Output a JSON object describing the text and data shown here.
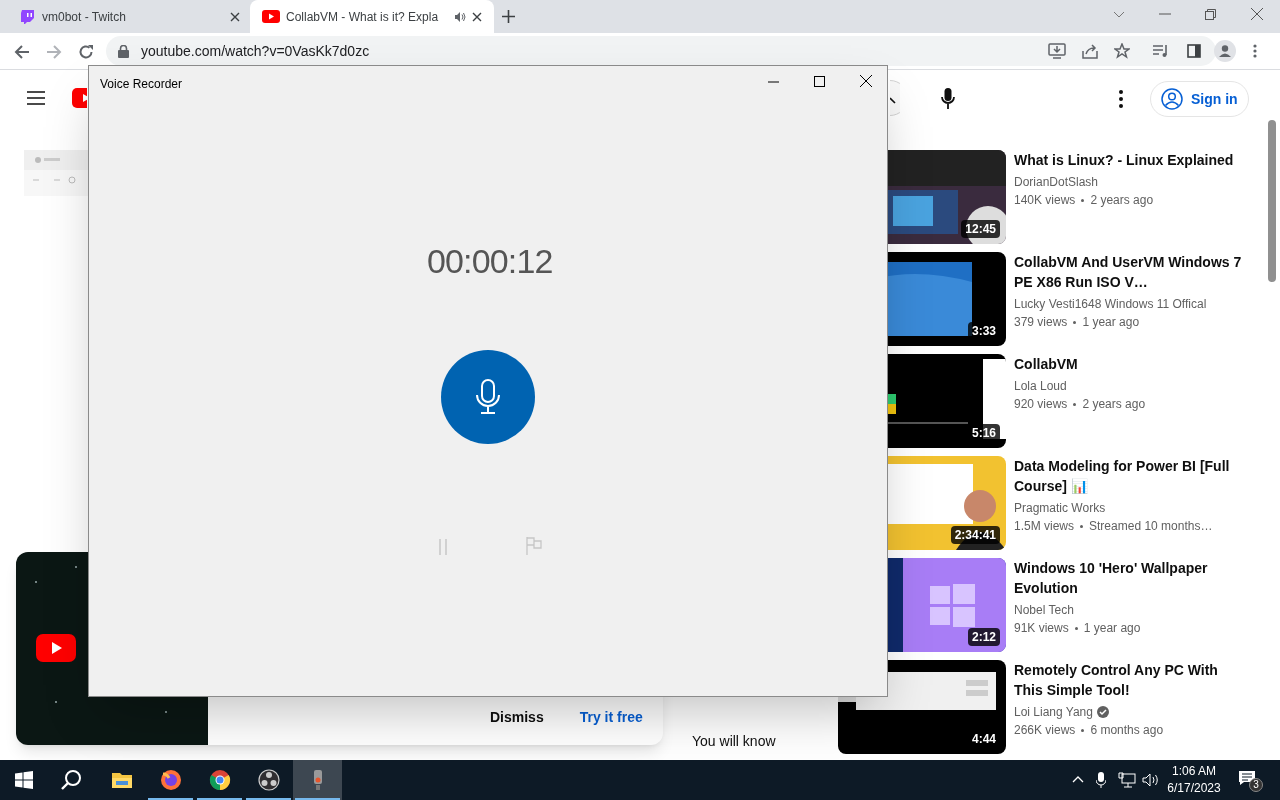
{
  "browser": {
    "tabs": [
      {
        "title": "vm0bot - Twitch",
        "kind": "twitch",
        "selected": false,
        "audio": false
      },
      {
        "title": "CollabVM - What is it? Expla",
        "kind": "youtube",
        "selected": true,
        "audio": true
      }
    ],
    "url": "youtube.com/watch?v=0VasKk7d0zc"
  },
  "youtube": {
    "sign_in": "Sign in",
    "recommendations": [
      {
        "title": "What is Linux? - Linux Explained",
        "channel": "DorianDotSlash",
        "views": "140K views",
        "age": "2 years ago",
        "duration": "12:45",
        "verified": false
      },
      {
        "title": "CollabVM And UserVM Windows 7 PE X86 Run ISO V…",
        "channel": "Lucky Vesti1648 Windows 11 Offical",
        "views": "379 views",
        "age": "1 year ago",
        "duration": "3:33",
        "verified": false
      },
      {
        "title": "CollabVM",
        "channel": "Lola Loud",
        "views": "920 views",
        "age": "2 years ago",
        "duration": "5:16",
        "verified": false
      },
      {
        "title": "Data Modeling for Power BI [Full Course] 📊",
        "channel": "Pragmatic Works",
        "views": "1.5M views",
        "age": "Streamed 10 months…",
        "duration": "2:34:41",
        "verified": false
      },
      {
        "title": "Windows 10 'Hero' Wallpaper Evolution",
        "channel": "Nobel Tech",
        "views": "91K views",
        "age": "1 year ago",
        "duration": "2:12",
        "verified": false
      },
      {
        "title": "Remotely Control Any PC With This Simple Tool!",
        "channel": "Loi Liang Yang",
        "views": "266K views",
        "age": "6 months ago",
        "duration": "4:44",
        "verified": true
      }
    ],
    "promo": {
      "buttons": [
        {
          "label": "Dismiss",
          "kind": "plain"
        },
        {
          "label": "Try it free",
          "kind": "primary"
        }
      ]
    },
    "description": "You will know"
  },
  "recorder": {
    "title": "Voice Recorder",
    "elapsed": "00:00:12",
    "controls_disabled": true
  },
  "taskbar": {
    "apps": [
      {
        "kind": "explorer",
        "running": false,
        "selected": false
      },
      {
        "kind": "firefox",
        "running": true,
        "selected": false
      },
      {
        "kind": "chrome",
        "running": true,
        "selected": false
      },
      {
        "kind": "obs",
        "running": true,
        "selected": false
      },
      {
        "kind": "recorder",
        "running": true,
        "selected": true
      }
    ],
    "time": "1:06 AM",
    "date": "6/17/2023",
    "notifications": "3"
  }
}
